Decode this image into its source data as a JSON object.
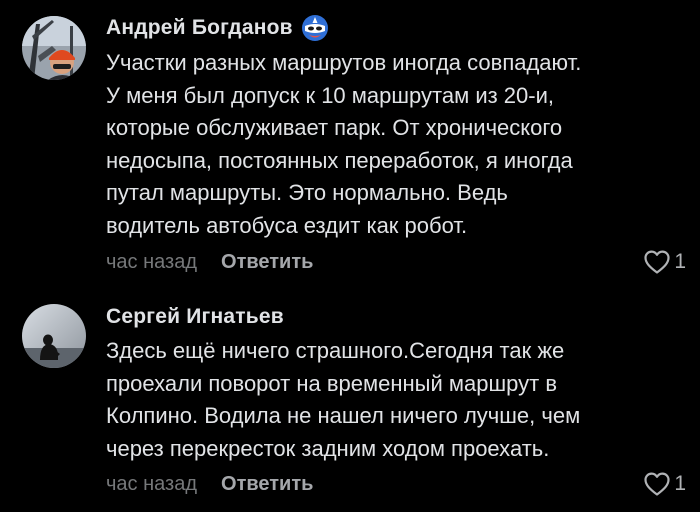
{
  "comments": [
    {
      "author": "Андрей Богданов",
      "badge_icon": "captain-shield-mask-icon",
      "text": "Участки разных маршрутов иногда совпадают.\nУ меня был допуск к 10 маршрутам из 20-и,\nкоторые обслуживает парк. От хронического\nнедосыпа, постоянных переработок, я иногда\nпутал маршруты. Это нормально. Ведь\nводитель автобуса ездит как робот.",
      "time": "час назад",
      "reply_label": "Ответить",
      "likes": "1"
    },
    {
      "author": "Сергей Игнатьев",
      "text": "Здесь ещё ничего страшного.Сегодня так же\nпроехали поворот на временный маршрут в\nКолпино. Водила не нашел ничего лучше, чем\nчерез перекресток задним ходом проехать.",
      "time": "час назад",
      "reply_label": "Ответить",
      "likes": "1"
    }
  ],
  "colors": {
    "background": "#000000",
    "text_primary": "#e1e3e6",
    "text_secondary": "#76787a",
    "reply": "#a5a7ab"
  }
}
